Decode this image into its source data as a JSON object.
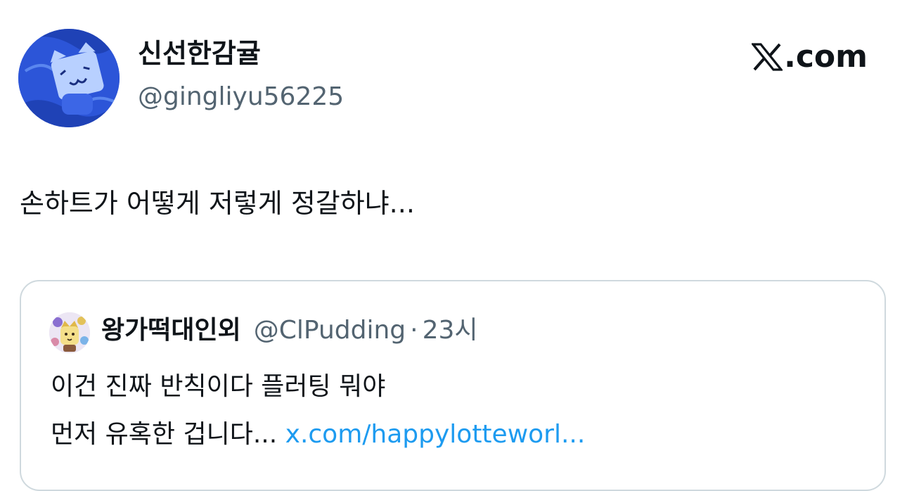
{
  "author": {
    "display_name": "신선한감귤",
    "handle": "@gingliyu56225",
    "avatar_icon": "blue-character-avatar"
  },
  "brand": {
    "label": ".com",
    "icon": "x-logo-icon"
  },
  "tweet": {
    "text": "손하트가 어떻게 저렇게 정갈하냐..."
  },
  "quote": {
    "display_name": "왕가떡대인외",
    "handle": "@ClPudding",
    "separator": "·",
    "time": "23시",
    "line1": "이건 진짜 반칙이다 플러팅 뭐야",
    "line2_text": "먼저 유혹한 겁니다...",
    "line2_link": "x.com/happylotteworl...",
    "avatar_icon": "pudding-character-avatar"
  },
  "colors": {
    "text": "#0f1419",
    "secondary": "#536471",
    "link": "#1d9bf0",
    "border": "#cfd9de"
  }
}
